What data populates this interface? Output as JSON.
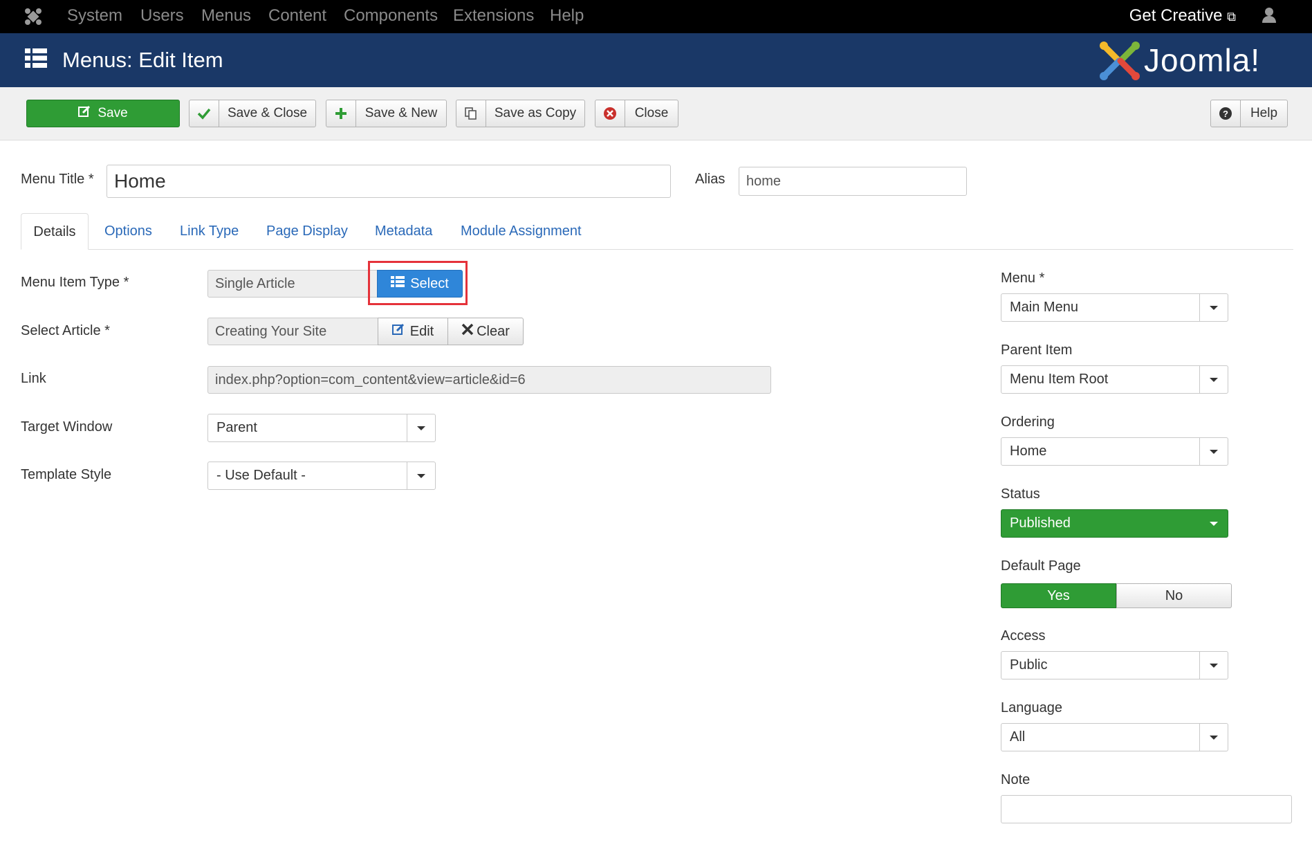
{
  "topnav": {
    "menu": [
      "System",
      "Users",
      "Menus",
      "Content",
      "Components",
      "Extensions",
      "Help"
    ],
    "brand_link": "Get Creative"
  },
  "header": {
    "title": "Menus: Edit Item",
    "logo_text": "Joomla!"
  },
  "toolbar": {
    "save": "Save",
    "save_close": "Save & Close",
    "save_new": "Save & New",
    "save_copy": "Save as Copy",
    "close": "Close",
    "help": "Help"
  },
  "form": {
    "menu_title_label": "Menu Title *",
    "menu_title_value": "Home",
    "alias_label": "Alias",
    "alias_value": "home"
  },
  "tabs": [
    "Details",
    "Options",
    "Link Type",
    "Page Display",
    "Metadata",
    "Module Assignment"
  ],
  "details": {
    "menu_item_type_label": "Menu Item Type *",
    "menu_item_type_value": "Single Article",
    "select_button": "Select",
    "select_article_label": "Select Article *",
    "select_article_value": "Creating Your Site",
    "edit_button": "Edit",
    "clear_button": "Clear",
    "link_label": "Link",
    "link_value": "index.php?option=com_content&view=article&id=6",
    "target_window_label": "Target Window",
    "target_window_value": "Parent",
    "template_style_label": "Template Style",
    "template_style_value": "- Use Default -"
  },
  "sidebar": {
    "menu_label": "Menu *",
    "menu_value": "Main Menu",
    "parent_label": "Parent Item",
    "parent_value": "Menu Item Root",
    "ordering_label": "Ordering",
    "ordering_value": "Home",
    "status_label": "Status",
    "status_value": "Published",
    "default_page_label": "Default Page",
    "default_yes": "Yes",
    "default_no": "No",
    "access_label": "Access",
    "access_value": "Public",
    "language_label": "Language",
    "language_value": "All",
    "note_label": "Note",
    "note_value": ""
  },
  "colors": {
    "header_bg": "#1a3867",
    "save_green": "#2f9c35",
    "select_blue": "#2f86d9",
    "highlight_red": "#e5323a",
    "link_blue": "#2a69b8"
  }
}
